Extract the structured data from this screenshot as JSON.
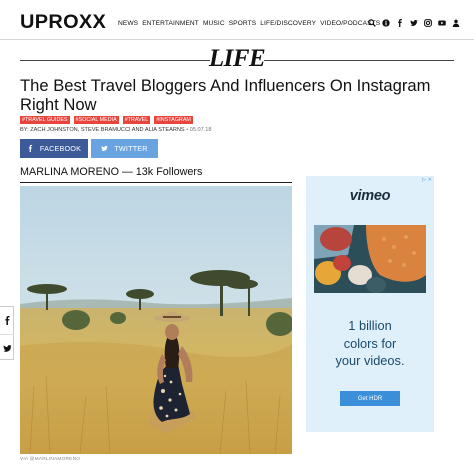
{
  "header": {
    "logo": "UPROXX",
    "nav": [
      "NEWS",
      "ENTERTAINMENT",
      "MUSIC",
      "SPORTS",
      "LIFE/DISCOVERY",
      "VIDEO/PODCASTS"
    ],
    "icons": [
      "search-icon",
      "info-icon",
      "facebook-icon",
      "twitter-icon",
      "instagram-icon",
      "youtube-icon",
      "user-icon"
    ]
  },
  "section": {
    "title": "LIFE"
  },
  "article": {
    "headline": "The Best Travel Bloggers And Influencers On Instagram Right Now",
    "tags": [
      "#TRAVEL GUIDES",
      "#SOCIAL MEDIA",
      "#TRAVEL",
      "#INSTAGRAM"
    ],
    "byline": "BY: ZACH JOHNSTON, STEVE BRAMUCCI AND ALIA STEARNS",
    "date": "05.07.18",
    "share": {
      "facebook": "FACEBOOK",
      "twitter": "TWITTER"
    },
    "influencer_heading": "MARLINA MORENO — 13k Followers",
    "photo_credit": "VIA @MARLINAMORENO"
  },
  "ad": {
    "logo": "vimeo",
    "copy": [
      "1 billion",
      "colors for",
      "your videos."
    ],
    "cta": "Get HDR"
  },
  "colors": {
    "facebook": "#3d5a98",
    "twitter": "#6aa4e0",
    "tag": "#e8453c",
    "ad_background": "#dff0fb",
    "ad_button": "#3b8fd8"
  }
}
